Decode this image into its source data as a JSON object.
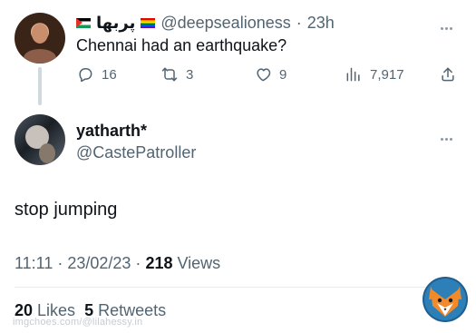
{
  "parent_tweet": {
    "display_name": "پربها",
    "handle": "@deepsealioness",
    "time_separator": "·",
    "time": "23h",
    "text": "Chennai had an earthquake?",
    "reply_count": "16",
    "retweet_count": "3",
    "like_count": "9",
    "view_count": "7,917"
  },
  "reply_tweet": {
    "display_name": "yatharth*",
    "handle": "@CastePatroller",
    "text": "stop jumping",
    "timestamp": "11:11 · 23/02/23 · ",
    "views_count": "218",
    "views_label": " Views",
    "likes_count": "20",
    "likes_label": " Likes",
    "retweets_count": "5",
    "retweets_label": " Retweets"
  },
  "watermark": {
    "text": "imgchoes.com/@lilahessy.in"
  },
  "icons": {
    "flags": [
      "palestine-flag-icon",
      "rainbow-flag-icon"
    ],
    "actions": [
      "reply-icon",
      "retweet-icon",
      "like-icon",
      "views-icon",
      "share-icon",
      "more-icon"
    ],
    "watermark_logo": "fox-logo-icon"
  },
  "colors": {
    "text_primary": "#0f1419",
    "text_secondary": "#536471",
    "divider": "#e7ebee",
    "thread_line": "#cfd9de",
    "watermark_fox": "#f08a2b"
  }
}
